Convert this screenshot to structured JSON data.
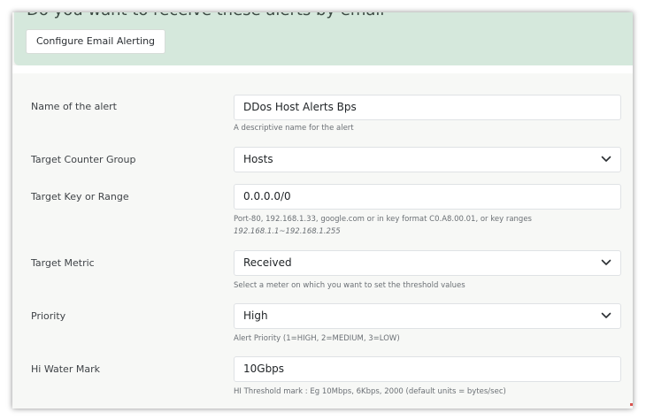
{
  "email_banner": {
    "title": "Do you want to receive these alerts by email",
    "button_label": "Configure Email Alerting"
  },
  "form": {
    "alert_name": {
      "label": "Name of the alert",
      "value": "DDos Host Alerts Bps",
      "help": "A descriptive name for the alert"
    },
    "counter_group": {
      "label": "Target Counter Group",
      "value": "Hosts"
    },
    "key_range": {
      "label": "Target Key or Range",
      "value": "0.0.0.0/0",
      "help": "Port-80, 192.168.1.33, google.com or in key format C0.A8.00.01, or key ranges",
      "help_example": "192.168.1.1~192.168.1.255"
    },
    "metric": {
      "label": "Target Metric",
      "value": "Received",
      "help": "Select a meter on which you want to set the threshold values"
    },
    "priority": {
      "label": "Priority",
      "value": "High",
      "help": "Alert Priority (1=HIGH, 2=MEDIUM, 3=LOW)"
    },
    "hi_water_mark": {
      "label": "Hi Water Mark",
      "value": "10Gbps",
      "help": "HI Threshold mark : Eg 10Mbps, 6Kbps, 2000 (default units = bytes/sec)"
    }
  },
  "icons": {
    "dropdown": "chevron-down-icon"
  }
}
